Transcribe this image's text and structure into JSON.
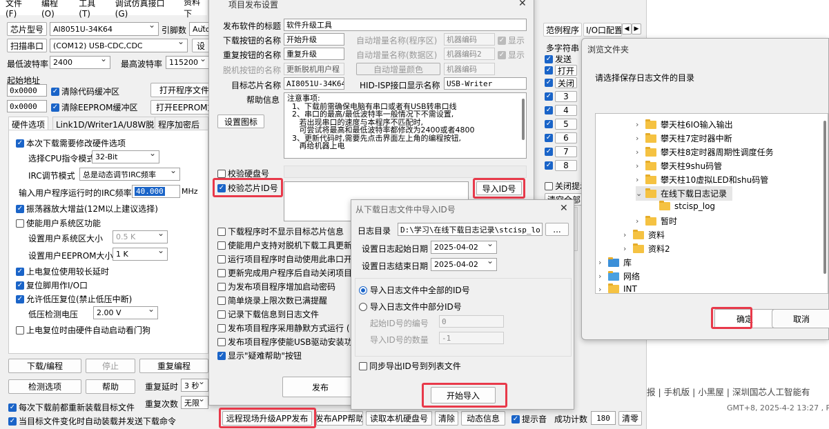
{
  "main": {
    "menu": [
      "文件(F)",
      "编程(O)",
      "工具(T)",
      "调试仿真接口(G)",
      "资料下"
    ],
    "chip_label": "芯片型号",
    "chip_value": "AI8051U-34K64",
    "pins_label": "引脚数",
    "pins_value": "Auto",
    "scan_label": "扫描串口",
    "port_value": "(COM12) USB-CDC,CDC",
    "set_label": "设",
    "min_baud_label": "最低波特率",
    "min_baud": "2400",
    "max_baud_label": "最高波特率",
    "max_baud": "115200",
    "start_addr_label": "起始地址",
    "addr1": "0x0000",
    "clear_code": "清除代码缓冲区",
    "open_prog": "打开程序文件",
    "addr2": "0x0000",
    "clear_eeprom": "清除EEPROM缓冲区",
    "open_eeprom": "打开EEPROM文件",
    "tabs": [
      "硬件选项",
      "Link1D/Writer1A/U8W脱机",
      "程序加密后"
    ],
    "hw_need": "本次下载需要修改硬件选项",
    "cpu_mode_label": "选择CPU指令模式",
    "cpu_mode": "32-Bit",
    "irc_label": "IRC调节模式",
    "irc_mode": "总是动态调节IRC频率",
    "irc_freq_label": "输入用户程序运行时的IRC频率",
    "irc_freq": "40.000",
    "irc_unit": "MHz",
    "osc_gain": "振荡器放大增益(12M以上建议选择)",
    "use_sys": "使能用户系统区功能",
    "sys_size_label": "设置用户系统区大小",
    "sys_size": "0.5 K",
    "eeprom_size_label": "设置用户EEPROM大小",
    "eeprom_size": "1   K",
    "power_delay": "上电复位使用较长延时",
    "reset_io": "复位脚用作I/O口",
    "low_volt_reset": "允许低压复位(禁止低压中断)",
    "low_volt_label": "低压检测电压",
    "low_volt": "2.00 V",
    "watchdog": "上电复位时由硬件自动启动看门狗",
    "download_btn": "下载/编程",
    "stop_btn": "停止",
    "redownload_btn": "重复编程",
    "detect_btn": "检测选项",
    "help_btn": "帮助",
    "repeat_delay_label": "重复延时",
    "repeat_delay": "3 秒",
    "repeat_count_label": "重复次数",
    "repeat_count": "无限",
    "reload_each": "每次下载前都重新装载目标文件",
    "auto_reload": "当目标文件变化时自动装载并发送下载命令",
    "bottom_btns": [
      "远程现场升级APP发布",
      "发布APP帮助",
      "读取本机硬盘号",
      "清除",
      "动态信息"
    ],
    "beep": "提示音",
    "success_label": "成功计数",
    "success_count": "180",
    "clear_count": "清零",
    "right_tabs": [
      "范例程序",
      "I/O口配置"
    ],
    "multi_label": "多字符串",
    "send_items": [
      "发送",
      "打开",
      "关闭",
      "3",
      "4",
      "5",
      "6",
      "7",
      "8"
    ],
    "close_auto": "关闭提示",
    "clear_all": "清空全部",
    "web_links": "报 | 手机版 | 小黑屋 | 深圳国芯人工智能有",
    "web_footer": "GMT+8, 2025-4-2 13:27 , Pro"
  },
  "publish": {
    "title": "项目发布设置",
    "sw_title_label": "发布软件的标题",
    "sw_title": "软件升级工具",
    "dl_btn_label": "下载按钮的名称",
    "dl_btn": "开始升级",
    "auto_prog_label": "自动增量名称(程序区)",
    "machine_code_label": "机器编码",
    "show_label": "显示",
    "rep_btn_label": "重复按钮的名称",
    "rep_btn": "重复升级",
    "auto_data_label": "自动增量名称(数据区)",
    "machine_code2_label": "机器编码2",
    "offline_label": "脱机按钮的名称",
    "offline_value": "更新脱机用户程",
    "auto_color": "自动增量颜色",
    "machine_code3": "机器编码",
    "target_label": "目标芯片名称",
    "target": "AI8051U-34K64",
    "hid_label": "HID-ISP接口显示名称",
    "hid_value": "USB-Writer",
    "help_label": "帮助信息",
    "help_text": [
      "注意事项:",
      "  1、下载前需确保电脑有串口或者有USB转串口线",
      "  2、串口的最高/最低波特率一般情况下不需设置,",
      "     若出现串口的速度与本程序不匹配时,",
      "     可尝试将最高和最低波特率都修改为2400或者4800",
      "  3、更新代码时,需要先点击界面左上角的编程按钮,",
      "     再给机器上电"
    ],
    "set_icon": "设置图标",
    "verify_disk": "校验硬盘号",
    "verify_chip": "校验芯片ID号",
    "import_id": "导入ID号",
    "opts": [
      "下载程序时不显示目标芯片信息",
      "使能用户支持对脱机下载工具更新用户程",
      "运行项目程序时自动使用此串口开",
      "更新完成用户程序后自动关闭项目",
      "为发布项目程序增加启动密码",
      "简单烧录上限次数已满提醒",
      "记录下载信息到日志文件",
      "发布项目程序采用静默方式运行 (",
      "发布项目程序使能USB驱动安装功能",
      "显示\"疑难帮助\"按钮"
    ],
    "publish_btn": "发布"
  },
  "import": {
    "title": "从下载日志文件中导入ID号",
    "dir_label": "日志目录",
    "dir_value": "D:\\学习\\在线下载日志记录\\stcisp_lo",
    "browse": "...",
    "start_label": "设置日志起始日期",
    "start_date": "2025-04-02",
    "end_label": "设置日志结束日期",
    "end_date": "2025-04-02",
    "all_ids": "导入日志文件中全部的ID号",
    "part_ids": "导入日志文件中部分ID号",
    "start_id_label": "起始ID号的编号",
    "start_id": "0",
    "count_label": "导入ID号的数量",
    "count": "-1",
    "sync_export": "同步导出ID号到列表文件",
    "start_btn": "开始导入"
  },
  "browse": {
    "title": "浏览文件夹",
    "prompt": "请选择保存日志文件的目录",
    "items": [
      "攀天柱6IO输入输出",
      "攀天柱7定时器中断",
      "攀天柱8定时器周期性调度任务",
      "攀天柱9shu码管",
      "攀天柱10虚拟LED和shu码管",
      "在线下载日志记录",
      "stcisp_log",
      "暂时",
      "资料",
      "资料2",
      "库",
      "网络",
      "INT"
    ],
    "ok": "确定",
    "cancel": "取消"
  }
}
